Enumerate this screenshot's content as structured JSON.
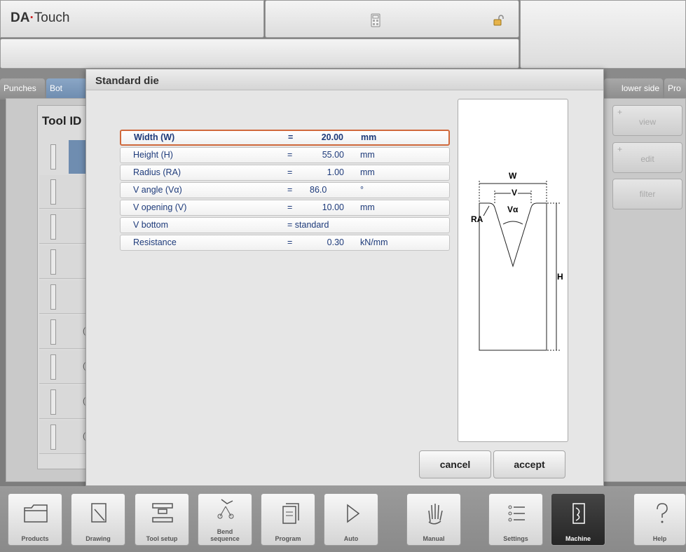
{
  "app": {
    "logo_prefix": "DA",
    "logo_dot": "·",
    "logo_suffix": "Touch"
  },
  "tabs": [
    {
      "label": "Punches"
    },
    {
      "label": "Bot"
    },
    {
      "label": "lower side"
    },
    {
      "label": "Pro"
    }
  ],
  "panel": {
    "tool_id_header": "Tool ID",
    "side_buttons": [
      {
        "label": "view",
        "plus": "+"
      },
      {
        "label": "edit",
        "plus": "+"
      },
      {
        "label": "filter"
      }
    ],
    "row_suffix": "("
  },
  "dialog": {
    "title": "Standard die",
    "params": [
      {
        "name": "Width (W)",
        "eq": "=",
        "value": "20.00",
        "unit": "mm"
      },
      {
        "name": "Height (H)",
        "eq": "=",
        "value": "55.00",
        "unit": "mm"
      },
      {
        "name": "Radius (RA)",
        "eq": "=",
        "value": "1.00",
        "unit": "mm"
      },
      {
        "name": "V angle (Vα)",
        "eq": "=",
        "value": "86.0",
        "unit": "°"
      },
      {
        "name": "V opening (V)",
        "eq": "=",
        "value": "10.00",
        "unit": "mm"
      },
      {
        "name": "V bottom",
        "eq": "= standard",
        "value": "",
        "unit": ""
      },
      {
        "name": "Resistance",
        "eq": "=",
        "value": "0.30",
        "unit": "kN/mm"
      }
    ],
    "drawing_labels": {
      "w": "W",
      "v": "V",
      "va": "Vα",
      "ra": "RA",
      "h": "H"
    },
    "cancel_label": "cancel",
    "accept_label": "accept"
  },
  "toolbar": {
    "items": [
      {
        "label": "Products",
        "icon": "folder-icon"
      },
      {
        "label": "Drawing",
        "icon": "drawing-icon"
      },
      {
        "label": "Tool setup",
        "icon": "tool-setup-icon"
      },
      {
        "label": "sequence",
        "label_top": "Bend",
        "icon": "bend-sequence-icon"
      },
      {
        "label": "Program",
        "icon": "program-icon"
      },
      {
        "label": "Auto",
        "icon": "play-icon"
      },
      {
        "label": "Manual",
        "icon": "hand-icon"
      },
      {
        "label": "Settings",
        "icon": "settings-icon"
      },
      {
        "label": "Machine",
        "icon": "machine-icon",
        "active": true
      },
      {
        "label": "Help",
        "icon": "help-icon"
      }
    ]
  }
}
